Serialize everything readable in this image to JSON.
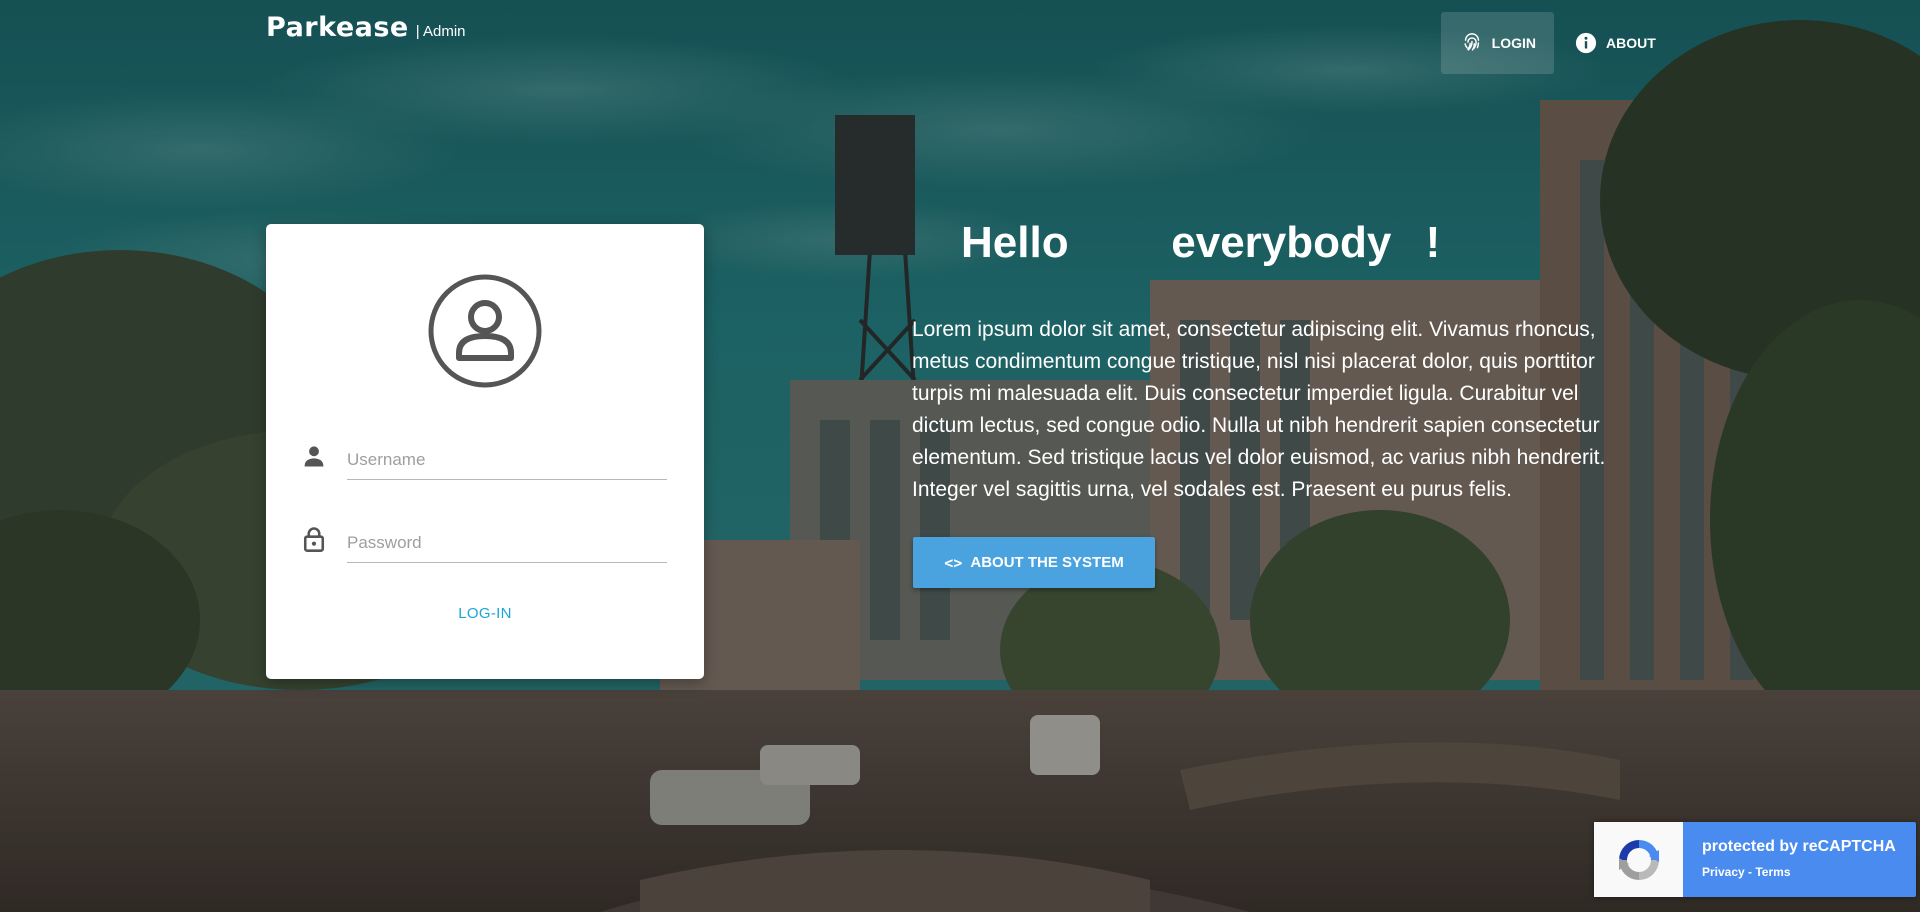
{
  "brand": {
    "name": "Parkease",
    "subtitle": "| Admin"
  },
  "nav": {
    "login_label": "LOGIN",
    "about_label": "ABOUT"
  },
  "login_form": {
    "username_placeholder": "Username",
    "password_placeholder": "Password",
    "submit_label": "LOG-IN"
  },
  "hero": {
    "title": "Hello   everybody !",
    "body": "Lorem ipsum dolor sit amet, consectetur adipiscing elit. Vivamus rhoncus, metus condimentum congue tristique, nisl nisi placerat dolor, quis porttitor turpis mi malesuada elit. Duis consectetur imperdiet ligula. Curabitur vel dictum lectus, sed congue odio. Nulla ut nibh hendrerit sapien consectetur elementum. Sed tristique lacus vel dolor euismod, ac varius nibh hendrerit. Integer vel sagittis urna, vel sodales est. Praesent eu purus felis.",
    "button_label": "ABOUT THE SYSTEM"
  },
  "recaptcha": {
    "title": "protected by reCAPTCHA",
    "links": "Privacy - Terms"
  },
  "colors": {
    "accent_button": "#4aa3df",
    "login_link": "#1aa5d8",
    "recaptcha_blue": "#4a8bf0",
    "sky": "#1f6f72"
  },
  "icons": {
    "nav_login": "fingerprint-icon",
    "nav_about": "info-icon",
    "avatar": "account-circle-icon",
    "username": "person-icon",
    "password": "lock-icon",
    "about_button": "code-icon",
    "recaptcha": "recaptcha-logo-icon"
  }
}
